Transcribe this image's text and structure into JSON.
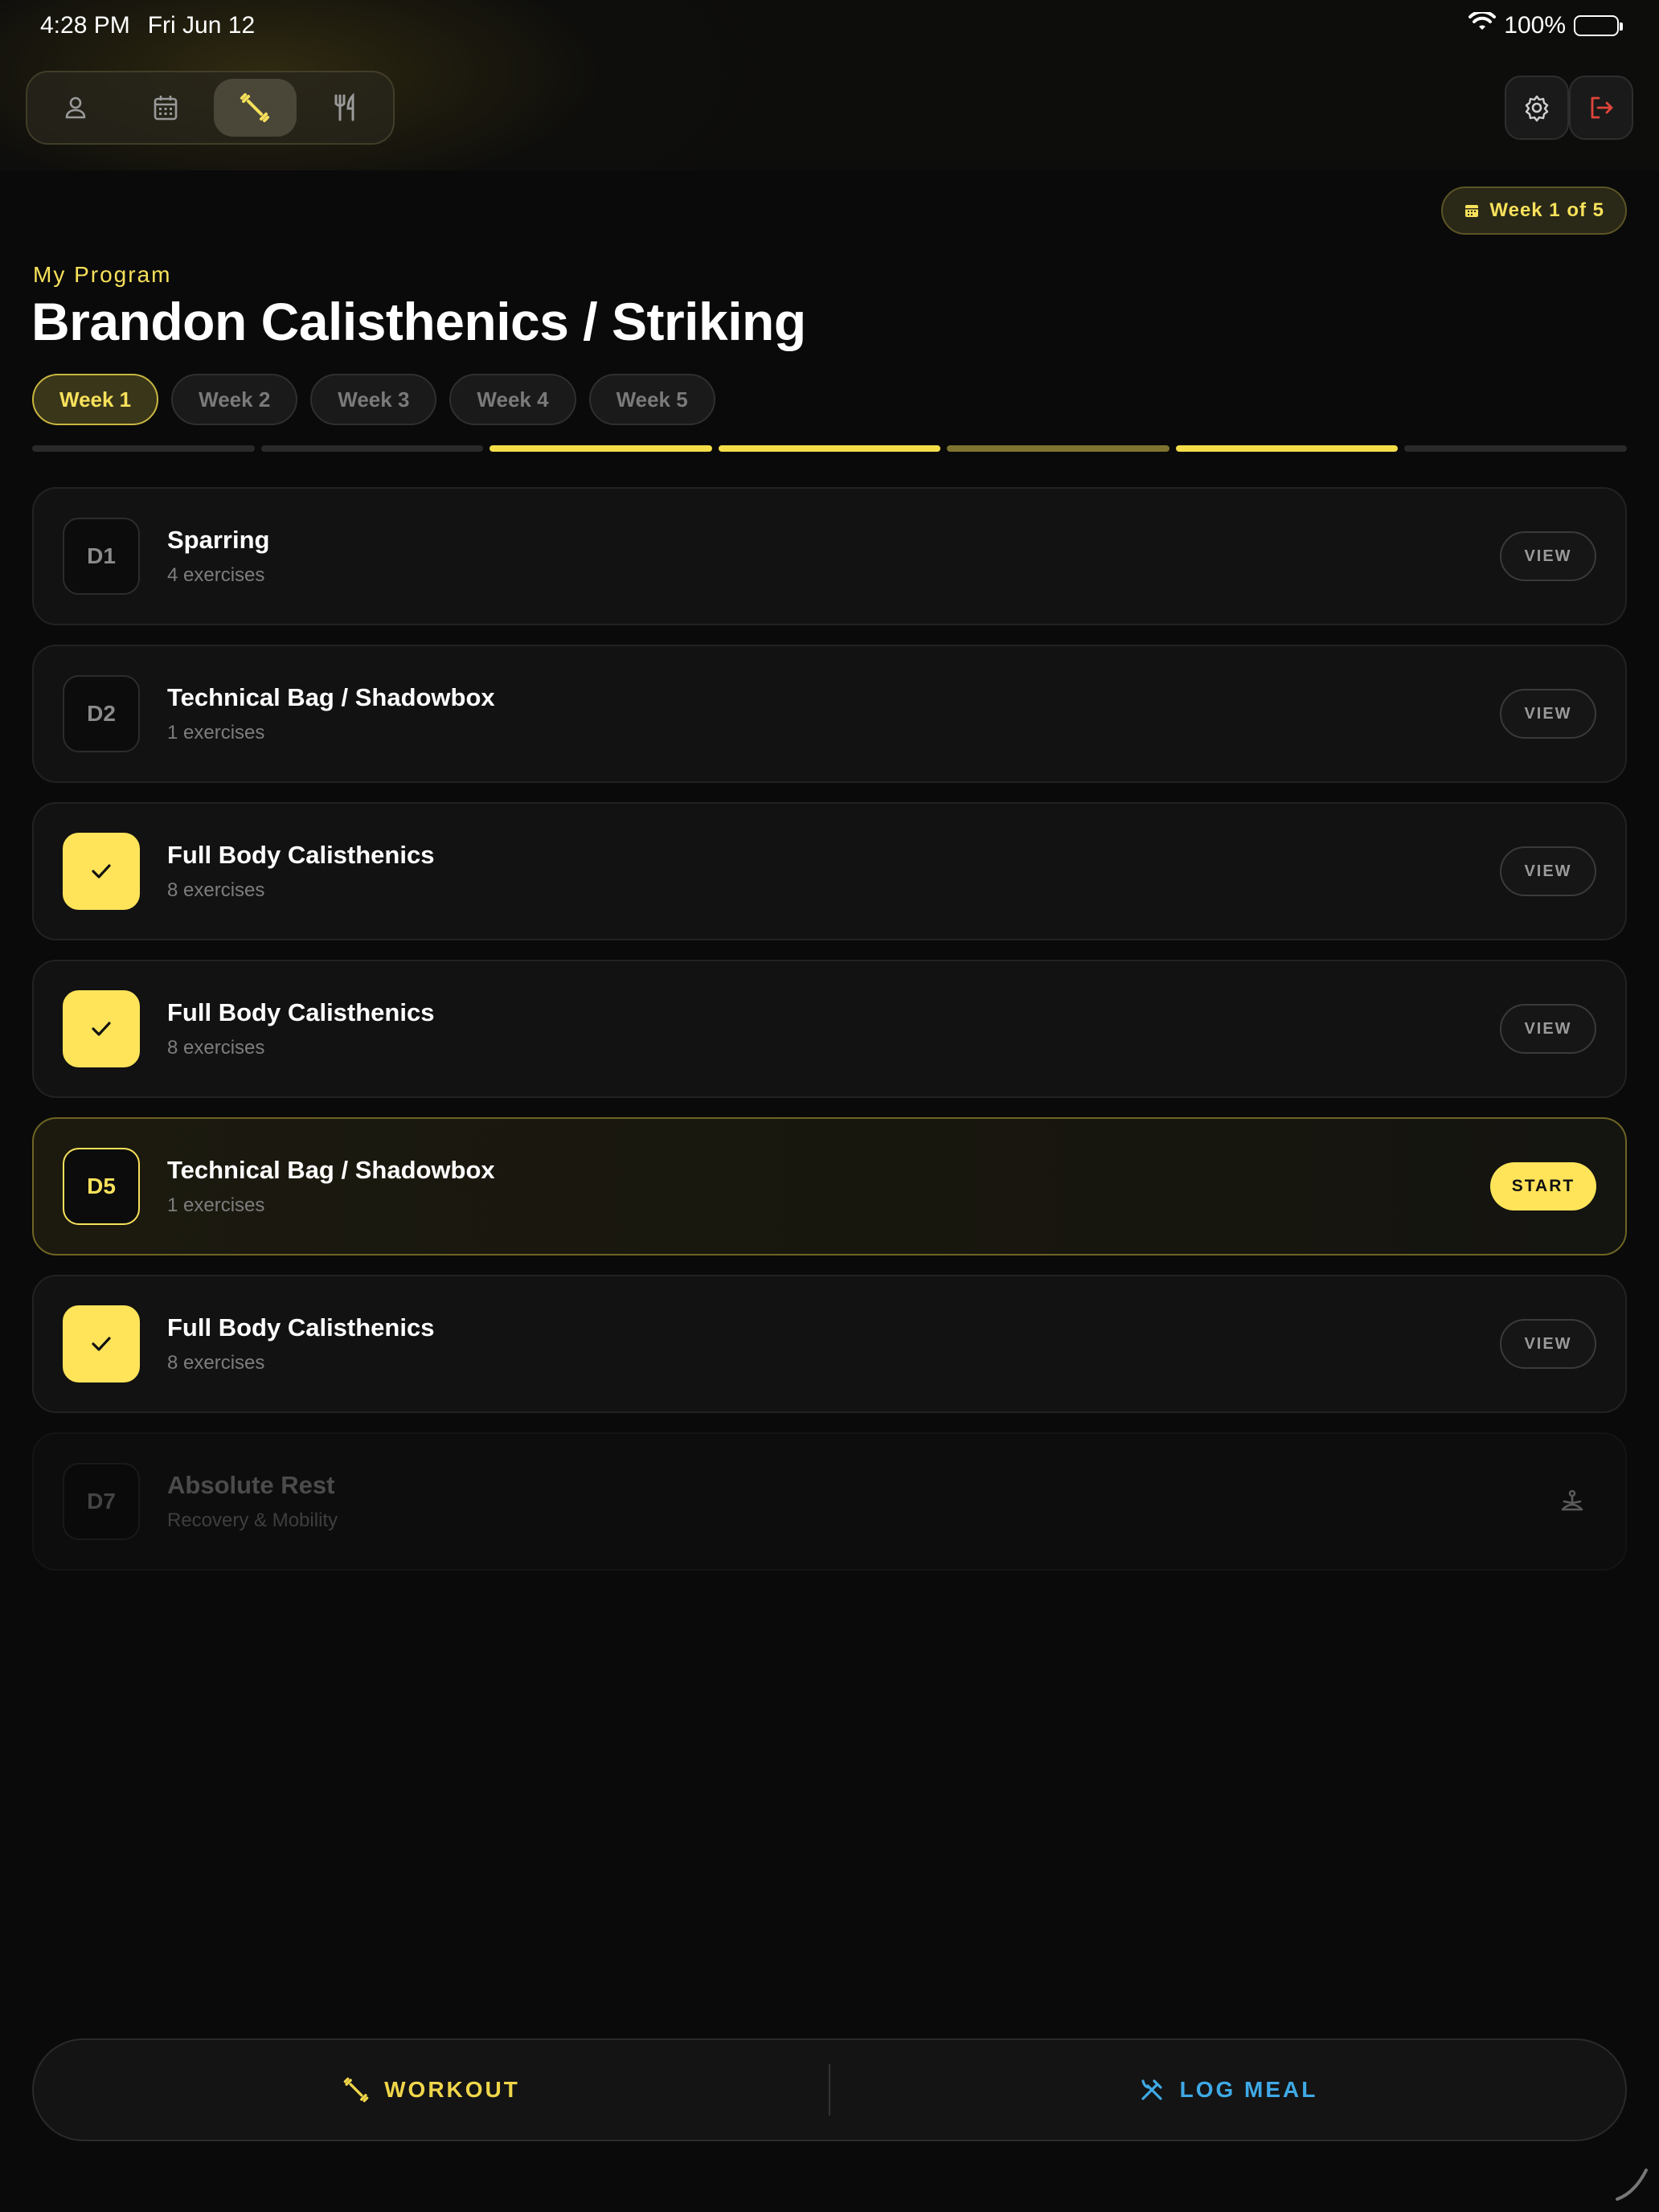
{
  "status": {
    "time": "4:28 PM",
    "date": "Fri Jun 12",
    "battery": "100%"
  },
  "nav": {
    "items": [
      "profile-icon",
      "calendar-icon",
      "dumbbell-icon",
      "fork-knife-icon"
    ],
    "active": "dumbbell-icon"
  },
  "week_badge": "Week 1 of 5",
  "eyebrow": "My Program",
  "title": "Brandon Calisthenics / Striking",
  "weeks": [
    "Week 1",
    "Week 2",
    "Week 3",
    "Week 4",
    "Week 5"
  ],
  "active_week": "Week 1",
  "days": [
    {
      "badge": "D1",
      "name": "Sparring",
      "sub": "4 exercises",
      "state": "pending",
      "action": "VIEW"
    },
    {
      "badge": "D2",
      "name": "Technical Bag / Shadowbox",
      "sub": "1 exercises",
      "state": "pending",
      "action": "VIEW"
    },
    {
      "badge": "",
      "name": "Full Body Calisthenics",
      "sub": "8 exercises",
      "state": "done",
      "action": "VIEW"
    },
    {
      "badge": "",
      "name": "Full Body Calisthenics",
      "sub": "8 exercises",
      "state": "done",
      "action": "VIEW"
    },
    {
      "badge": "D5",
      "name": "Technical Bag / Shadowbox",
      "sub": "1 exercises",
      "state": "current",
      "action": "START"
    },
    {
      "badge": "",
      "name": "Full Body Calisthenics",
      "sub": "8 exercises",
      "state": "done",
      "action": "VIEW"
    },
    {
      "badge": "D7",
      "name": "Absolute Rest",
      "sub": "Recovery & Mobility",
      "state": "rest",
      "action": ""
    }
  ],
  "bottom": {
    "workout": "WORKOUT",
    "meal": "LOG MEAL"
  },
  "colors": {
    "accent": "#ffe45a",
    "meal": "#3fa9e6",
    "logout": "#e0453a"
  }
}
